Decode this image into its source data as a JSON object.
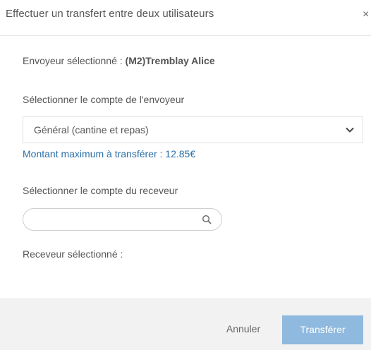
{
  "modal": {
    "title": "Effectuer un transfert entre deux utilisateurs",
    "close_symbol": "×"
  },
  "sender": {
    "prefix": "Envoyeur sélectionné : ",
    "name": "(M2)Tremblay Alice"
  },
  "sender_account": {
    "label": "Sélectionner le compte de l'envoyeur",
    "selected": "Général (cantine et repas)",
    "max_amount_text": "Montant maximum à transférer : 12.85€"
  },
  "receiver_account": {
    "label": "Sélectionner le compte du receveur",
    "search_value": "",
    "search_placeholder": ""
  },
  "receiver": {
    "label": "Receveur sélectionné :"
  },
  "footer": {
    "cancel_label": "Annuler",
    "transfer_label": "Transférer"
  },
  "colors": {
    "link_blue": "#2a6fa8",
    "primary_button": "#8fb9de",
    "footer_bg": "#f2f2f2"
  },
  "icons": {
    "close": "close-icon",
    "dropdown": "chevron-down-icon",
    "search": "search-icon"
  }
}
